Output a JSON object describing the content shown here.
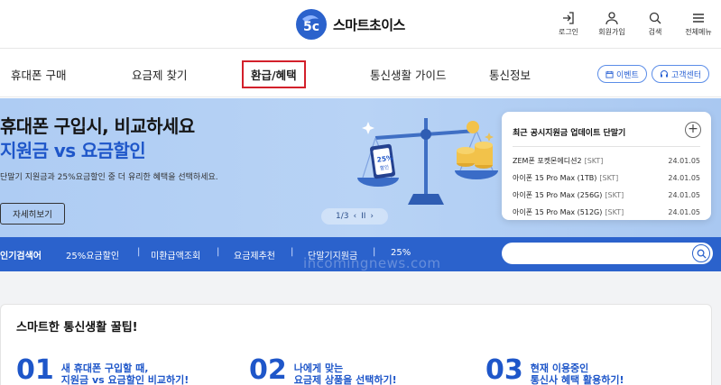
{
  "brand": {
    "name": "스마트초이스",
    "accent": "#2b62cc",
    "highlight": "#1e56c9",
    "logo_dark": "#1f3f8f"
  },
  "top_util": [
    {
      "label": "로그인",
      "icon": "login-icon"
    },
    {
      "label": "회원가입",
      "icon": "person-icon"
    },
    {
      "label": "검색",
      "icon": "search-icon"
    },
    {
      "label": "전체메뉴",
      "icon": "menu-icon"
    }
  ],
  "gnb": {
    "items": [
      "휴대폰 구매",
      "요금제 찾기",
      "환급/혜택",
      "통신생활 가이드",
      "통신정보"
    ],
    "active": "환급/혜택",
    "event": "이벤트",
    "support": "고객센터"
  },
  "hero": {
    "title1": "휴대폰 구입시, 비교하세요",
    "title2": "지원금 vs 요금할인",
    "desc": "단말기 지원금과 25%요금할인 중 더 유리한 혜택을 선택하세요.",
    "button": "자세히보기",
    "badge_line1": "25%",
    "badge_line2": "할인",
    "pager": {
      "current": "1/3",
      "prev": "‹",
      "pause": "II",
      "next": "›"
    }
  },
  "notice": {
    "title": "최근 공시지원금 업데이트 단말기",
    "more": "+",
    "rows": [
      {
        "device": "ZEM폰 포켓몬에디션2",
        "carrier": "[SKT]",
        "date": "24.01.05"
      },
      {
        "device": "아이폰 15 Pro Max (1TB)",
        "carrier": "[SKT]",
        "date": "24.01.05"
      },
      {
        "device": "아이폰 15 Pro Max (256G)",
        "carrier": "[SKT]",
        "date": "24.01.05"
      },
      {
        "device": "아이폰 15 Pro Max (512G)",
        "carrier": "[SKT]",
        "date": "24.01.05"
      }
    ]
  },
  "search": {
    "label": "인기검색어",
    "keywords": [
      "25%요금할인",
      "미환급액조회",
      "요금제추천",
      "단말기지원금",
      "25%"
    ],
    "separator": "|"
  },
  "watermark": "incomingnews.com",
  "tips": {
    "title": "스마트한 통신생활 꿀팁!",
    "items": [
      {
        "num": "01",
        "line1": "새 휴대폰 구입할 때,",
        "line2": "지원금 vs 요금할인 비교하기!"
      },
      {
        "num": "02",
        "line1": "나에게 맞는",
        "line2": "요금제 상품을 선택하기!"
      },
      {
        "num": "03",
        "line1": "현재 이용중인",
        "line2": "통신사 혜택 활용하기!"
      }
    ]
  }
}
